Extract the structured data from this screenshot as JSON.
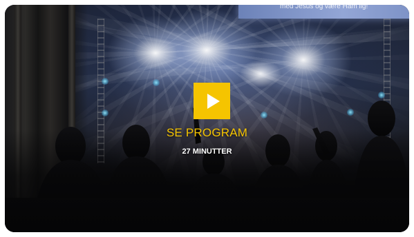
{
  "background": {
    "screen_text": "med Jesus og være Ham lig!"
  },
  "overlay": {
    "title": "SE PROGRAM",
    "duration": "27 MINUTTER",
    "play_icon": "play-icon",
    "accent_color": "#f5c400"
  }
}
